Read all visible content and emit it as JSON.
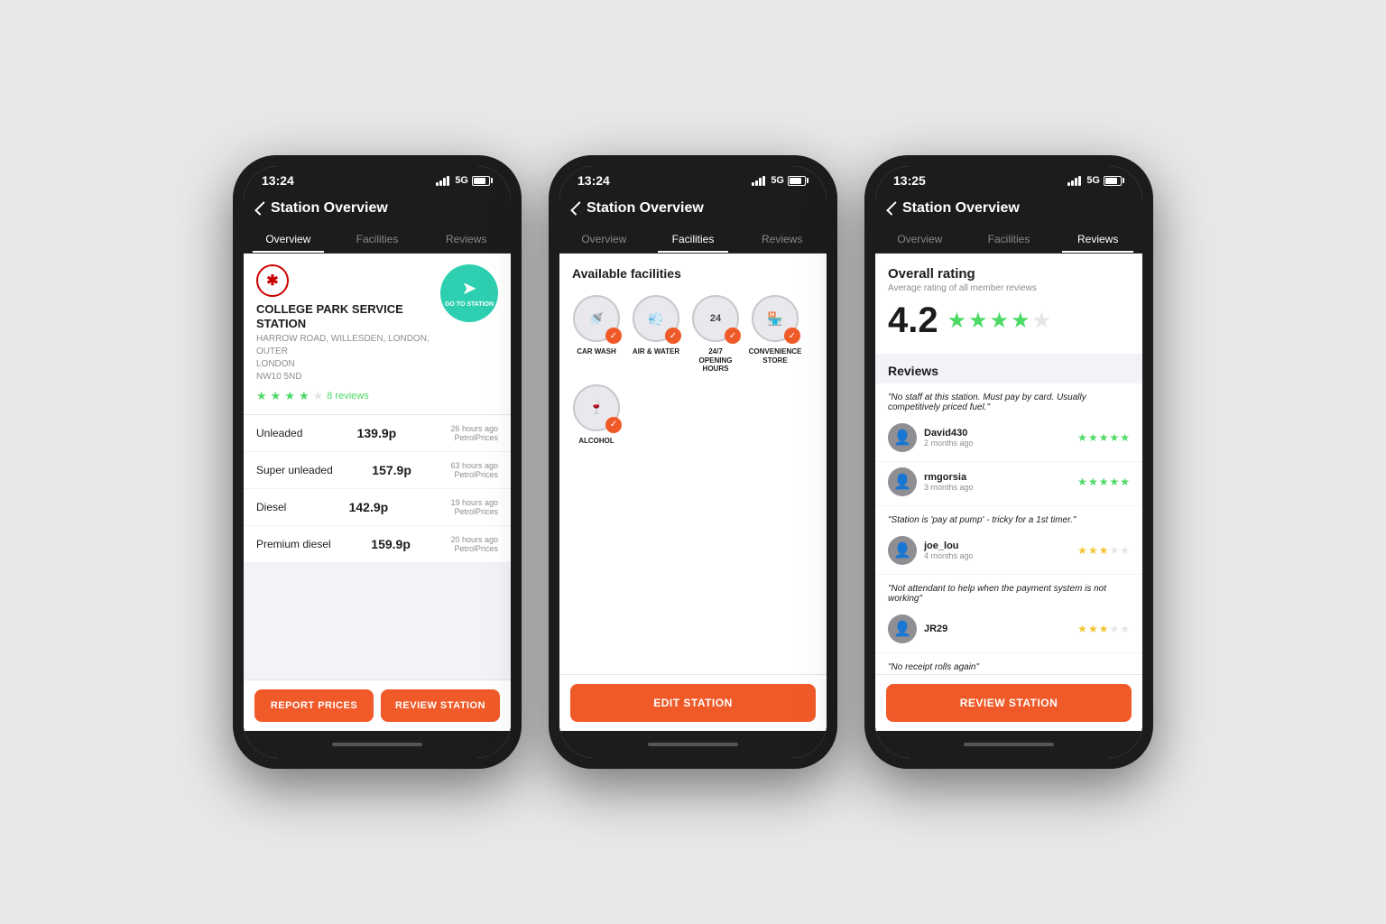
{
  "app": {
    "title": "Station Overview"
  },
  "status": {
    "time": "13:24",
    "time2": "13:24",
    "time3": "13:25",
    "network": "5G"
  },
  "tabs": {
    "overview": "Overview",
    "facilities": "Facilities",
    "reviews": "Reviews"
  },
  "station": {
    "name": "COLLEGE PARK SERVICE STATION",
    "address_line1": "HARROW ROAD, WILLESDEN, LONDON, OUTER",
    "address_line2": "LONDON",
    "address_line3": "NW10 5ND",
    "review_count": "8 reviews",
    "goto_label": "GO TO STATION"
  },
  "fuels": [
    {
      "name": "Unleaded",
      "price": "139.9p",
      "time": "26 hours ago",
      "source": "PetrolPrices"
    },
    {
      "name": "Super unleaded",
      "price": "157.9p",
      "time": "63 hours ago",
      "source": "PetrolPrices"
    },
    {
      "name": "Diesel",
      "price": "142.9p",
      "time": "19 hours ago",
      "source": "PetrolPrices"
    },
    {
      "name": "Premium diesel",
      "price": "159.9p",
      "time": "20 hours ago",
      "source": "PetrolPrices"
    }
  ],
  "buttons": {
    "report_prices": "REPORT PRICES",
    "review_station": "REVIEW STATION",
    "edit_station": "EDIT STATION"
  },
  "facilities": {
    "title": "Available facilities",
    "items": [
      {
        "icon": "🚿",
        "label": "CAR WASH",
        "checked": true
      },
      {
        "icon": "💨",
        "label": "AIR & WATER",
        "checked": true
      },
      {
        "icon": "24",
        "label": "24/7 OPENING HOURS",
        "checked": true
      },
      {
        "icon": "🏪",
        "label": "CONVENIENCE STORE",
        "checked": true
      },
      {
        "icon": "🍷",
        "label": "ALCOHOL",
        "checked": true
      }
    ]
  },
  "reviews": {
    "overall_title": "Overall rating",
    "overall_subtitle": "Average rating of all member reviews",
    "rating": "4.2",
    "section_title": "Reviews",
    "items": [
      {
        "quote": "\"No staff at this station. Must pay by card. Usually competitively priced fuel.\"",
        "username": "David430",
        "date": "2 months ago",
        "stars": 5,
        "star_color": "green"
      },
      {
        "quote": null,
        "username": "rmgorsia",
        "date": "3 months ago",
        "stars": 5,
        "star_color": "green"
      },
      {
        "quote": "\"Station is 'pay at pump' - tricky for a 1st timer.\"",
        "username": "joe_lou",
        "date": "4 months ago",
        "stars": 3,
        "star_color": "yellow"
      },
      {
        "quote": "\"Not attendant to help when the payment system is not working\"",
        "username": "JR29",
        "date": "",
        "stars": 3,
        "star_color": "yellow"
      }
    ],
    "final_quote": "\"No receipt rolls again\""
  }
}
